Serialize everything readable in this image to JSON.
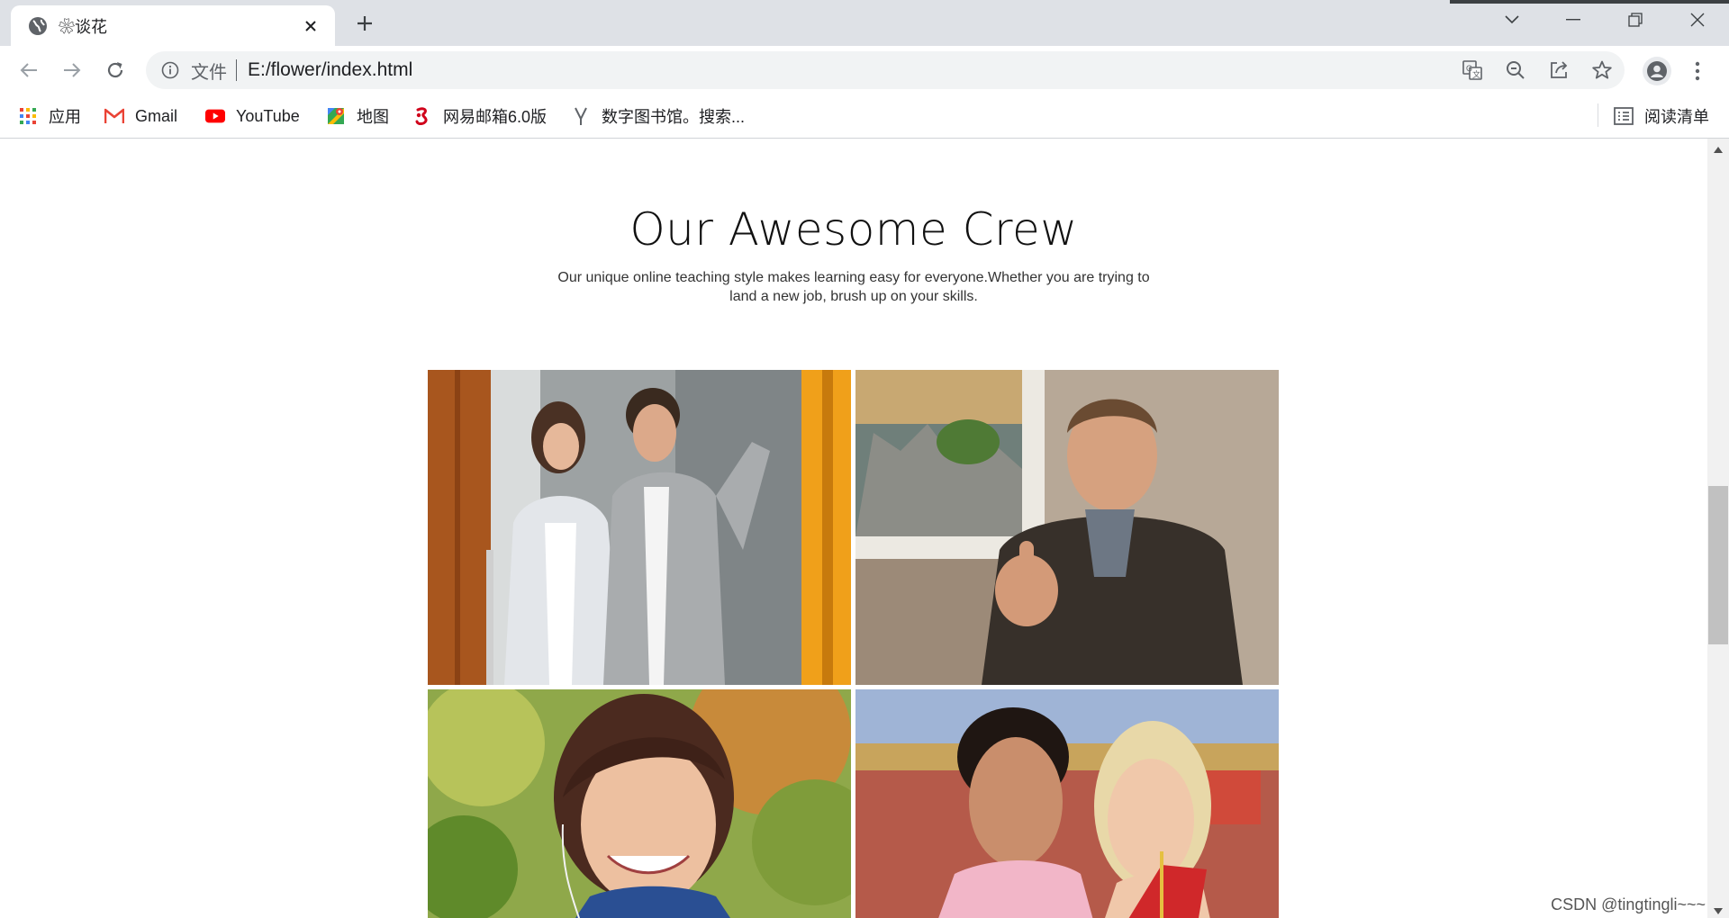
{
  "browser": {
    "tab_title": "❀谈花",
    "address": {
      "scheme_label": "文件",
      "url": "E:/flower/index.html"
    },
    "bookmarks": [
      {
        "label": "应用",
        "icon": "apps-grid-icon"
      },
      {
        "label": "Gmail",
        "icon": "gmail-icon"
      },
      {
        "label": "YouTube",
        "icon": "youtube-icon"
      },
      {
        "label": "地图",
        "icon": "maps-icon"
      },
      {
        "label": "网易邮箱6.0版",
        "icon": "netease-mail-icon"
      },
      {
        "label": "数字图书馆。搜索...",
        "icon": "library-icon"
      }
    ],
    "reading_list_label": "阅读清单"
  },
  "page": {
    "heading": "Our Awesome Crew",
    "subtitle": "Our unique online teaching style makes learning easy for everyone.Whether you are trying to land a new job, brush up on your skills."
  },
  "watermark": "CSDN @tingtingli~~~",
  "colors": {
    "accent_youtube": "#ff0000",
    "gmail_red": "#ea4335"
  }
}
